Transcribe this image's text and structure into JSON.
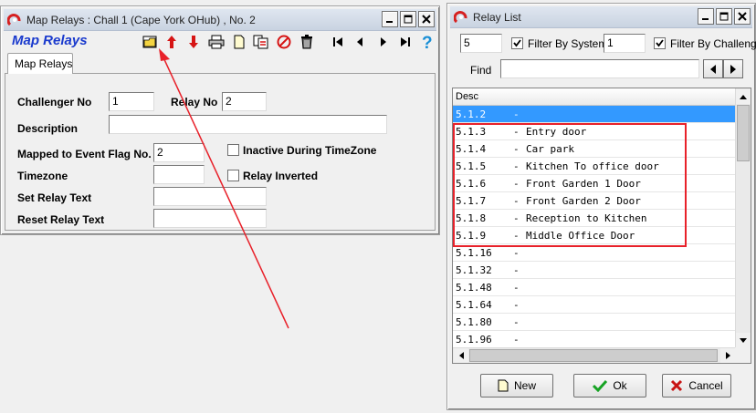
{
  "map_relays_window": {
    "title": "Map Relays : Chall 1 (Cape York OHub) , No. 2",
    "heading": "Map Relays",
    "tab_label": "Map Relays",
    "heading_color": "#1a3acd",
    "form": {
      "challenger_no_label": "Challenger No",
      "challenger_no_value": "1",
      "relay_no_label": "Relay No",
      "relay_no_value": "2",
      "description_label": "Description",
      "description_value": "",
      "mapped_flag_label": "Mapped to Event Flag No.",
      "mapped_flag_value": "2",
      "timezone_label": "Timezone",
      "timezone_value": "",
      "set_relay_text_label": "Set Relay Text",
      "set_relay_text_value": "",
      "reset_relay_text_label": "Reset Relay Text",
      "reset_relay_text_value": "",
      "inactive_label": "Inactive During TimeZone",
      "inverted_label": "Relay Inverted"
    },
    "toolbar_icons": [
      "open-folder-icon",
      "arrow-up-icon",
      "arrow-down-icon",
      "print-icon",
      "new-page-icon",
      "copy-icon",
      "delete-icon",
      "trash-icon",
      "first-record-icon",
      "prev-record-icon",
      "next-record-icon",
      "last-record-icon",
      "help-icon"
    ]
  },
  "relay_list_window": {
    "title": "Relay List",
    "filter_system_value": "5",
    "filter_system_label": "Filter By System",
    "filter_challenger_value": "1",
    "filter_challenger_label": "Filter By Challenger",
    "find_label": "Find",
    "find_value": "",
    "column_header": "Desc",
    "rows": [
      {
        "code": "5.1.2",
        "desc": ""
      },
      {
        "code": "5.1.3",
        "desc": "Entry door"
      },
      {
        "code": "5.1.4",
        "desc": "Car park"
      },
      {
        "code": "5.1.5",
        "desc": "Kitchen To office door"
      },
      {
        "code": "5.1.6",
        "desc": "Front Garden 1 Door"
      },
      {
        "code": "5.1.7",
        "desc": "Front Garden 2 Door"
      },
      {
        "code": "5.1.8",
        "desc": "Reception to Kitchen"
      },
      {
        "code": "5.1.9",
        "desc": "Middle Office Door"
      },
      {
        "code": "5.1.16",
        "desc": ""
      },
      {
        "code": "5.1.32",
        "desc": ""
      },
      {
        "code": "5.1.48",
        "desc": ""
      },
      {
        "code": "5.1.64",
        "desc": ""
      },
      {
        "code": "5.1.80",
        "desc": ""
      },
      {
        "code": "5.1.96",
        "desc": ""
      }
    ],
    "dash": "-",
    "buttons": {
      "new_label": "New",
      "ok_label": "Ok",
      "cancel_label": "Cancel"
    }
  },
  "colors": {
    "selection": "#3399ff",
    "annotation_red": "#e8212a"
  }
}
